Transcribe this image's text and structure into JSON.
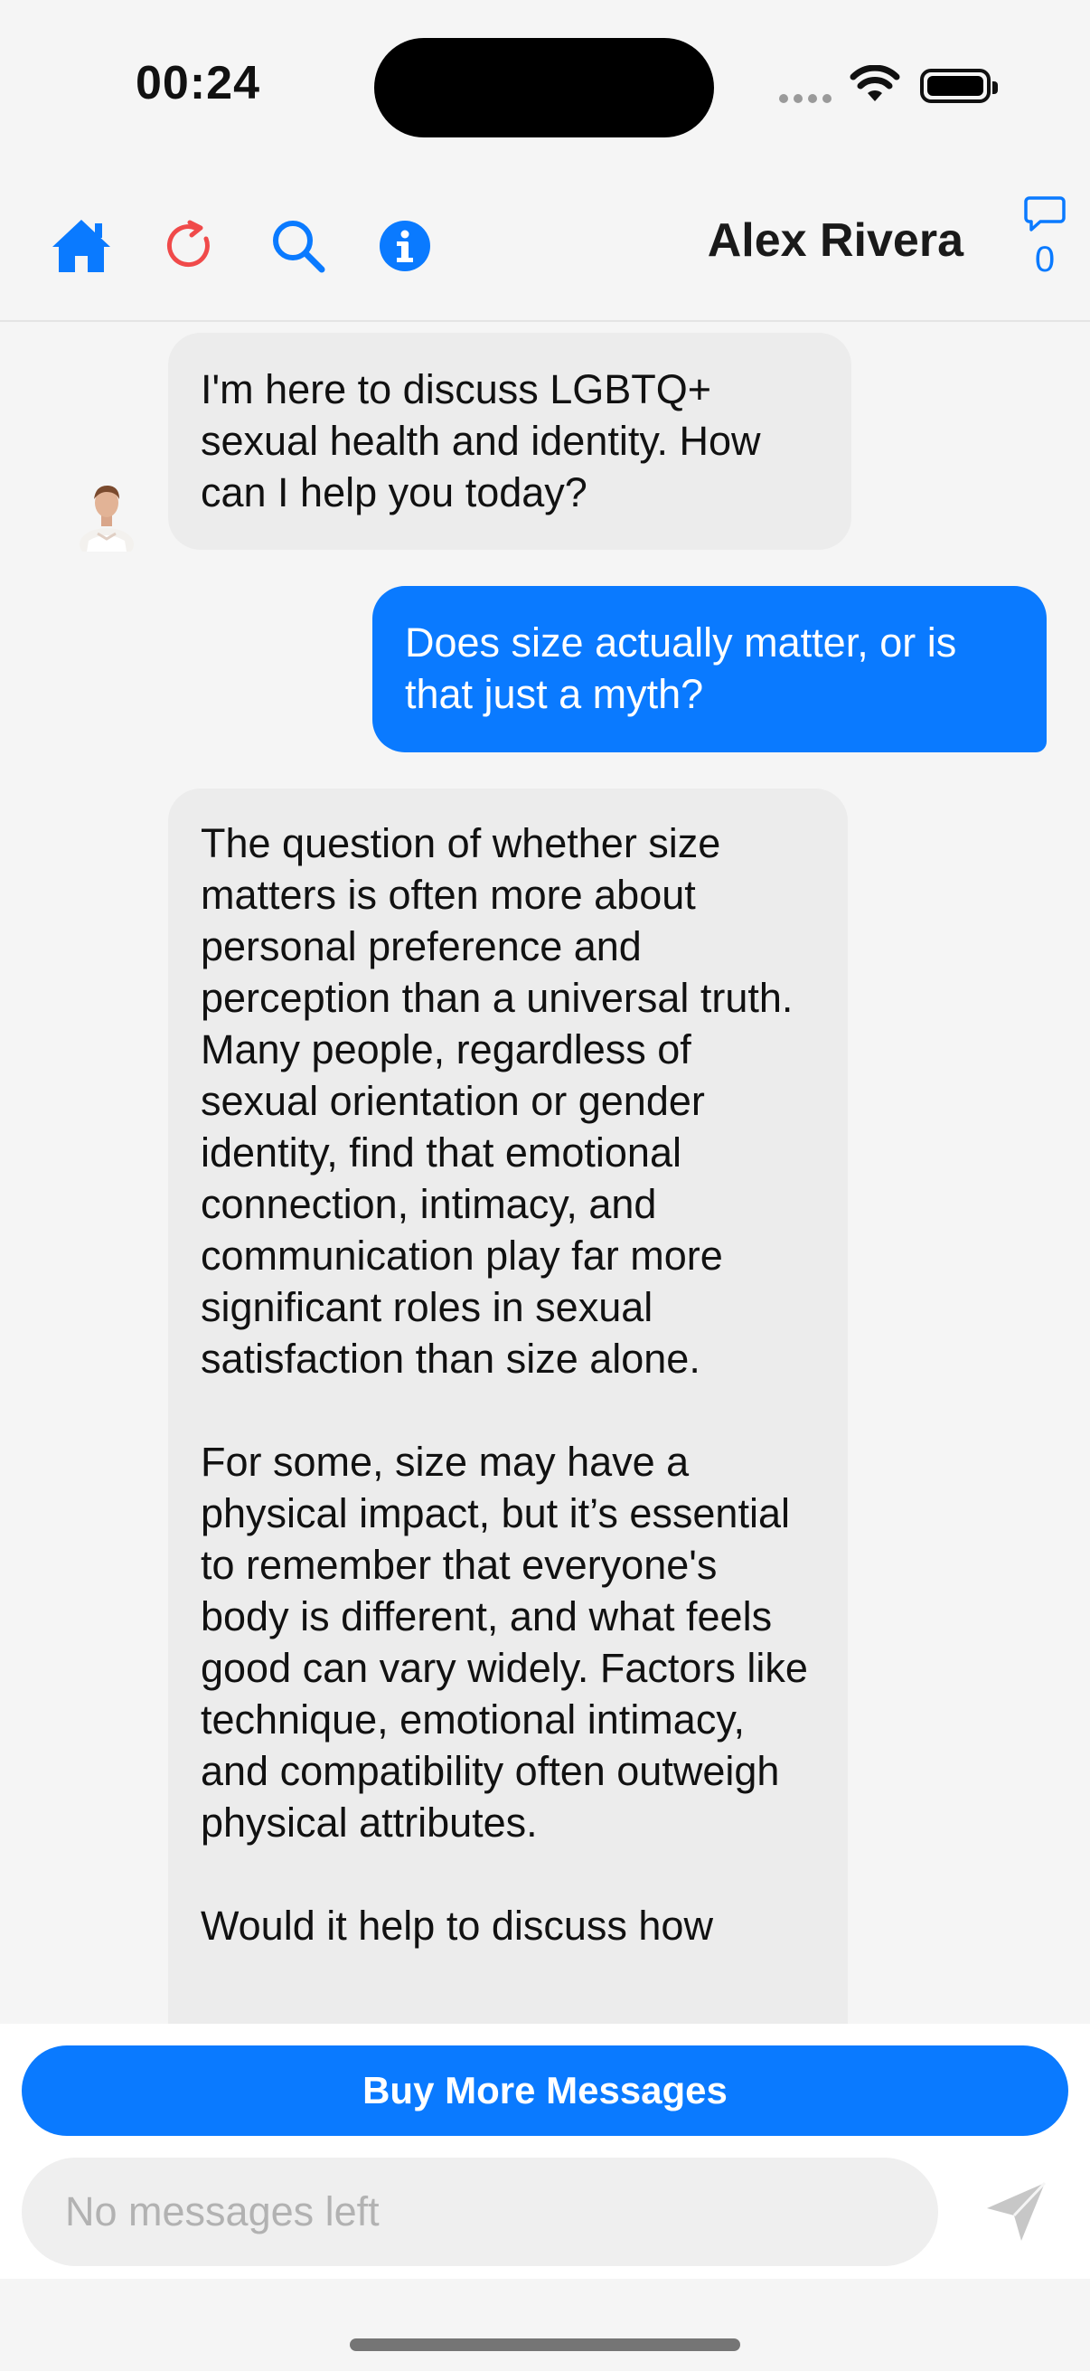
{
  "status_bar": {
    "time": "00:24"
  },
  "header": {
    "contact_name": "Alex Rivera",
    "message_count": "0",
    "icons": [
      "home-icon",
      "refresh-icon",
      "search-icon",
      "info-icon",
      "chat-bubble-icon"
    ]
  },
  "messages": [
    {
      "sender": "Alex Rivera",
      "direction": "incoming",
      "text": "I'm here to discuss LGBTQ+ sexual health and identity. How can I help you today?"
    },
    {
      "sender": "user",
      "direction": "outgoing",
      "text": "Does size actually matter, or is that just a myth?"
    },
    {
      "sender": "Alex Rivera",
      "direction": "incoming",
      "text": "The question of whether size matters is often more about personal preference and perception than a universal truth. Many people, regardless of sexual orientation or gender identity, find that emotional connection, intimacy, and communication play far more significant roles in sexual satisfaction than size alone.\n\nFor some, size may have a physical impact, but it’s essential to remember that everyone's body is different, and what feels good can vary widely. Factors like technique, emotional intimacy, and compatibility often outweigh physical attributes.\n\nWould it help to discuss how"
    }
  ],
  "bottom": {
    "buy_button_label": "Buy More Messages",
    "input_placeholder": "No messages left"
  },
  "colors": {
    "accent": "#0a7aff",
    "refresh": "#f04a4a",
    "incoming_bubble": "#ececec"
  }
}
